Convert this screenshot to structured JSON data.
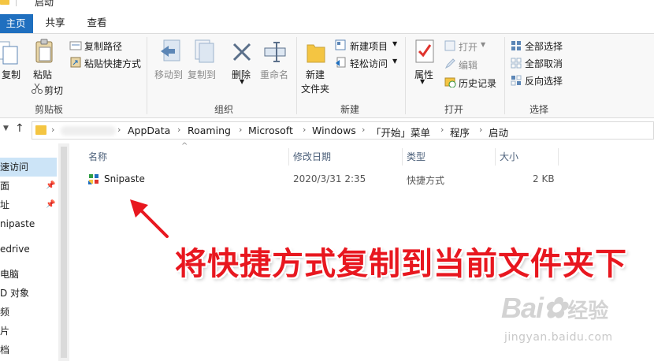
{
  "window": {
    "title": "启动"
  },
  "ribbon_tabs": [
    "主页",
    "共享",
    "查看"
  ],
  "ribbon": {
    "clipboard": {
      "copy": "复制",
      "paste": "粘贴",
      "copy_path": "复制路径",
      "paste_shortcut": "粘贴快捷方式",
      "cut": "剪切",
      "label": "剪贴板"
    },
    "organize": {
      "move_to": "移动到",
      "copy_to": "复制到",
      "delete": "删除",
      "rename": "重命名",
      "label": "组织"
    },
    "new": {
      "new_folder_line1": "新建",
      "new_folder_line2": "文件夹",
      "new_item": "新建项目",
      "easy_access": "轻松访问",
      "label": "新建"
    },
    "open": {
      "properties": "属性",
      "open": "打开",
      "edit": "编辑",
      "history": "历史记录",
      "label": "打开"
    },
    "select": {
      "select_all": "全部选择",
      "select_none": "全部取消",
      "invert": "反向选择",
      "label": "选择"
    }
  },
  "address_bar": {
    "crumbs": [
      "AppData",
      "Roaming",
      "Microsoft",
      "Windows",
      "「开始」菜单",
      "程序",
      "启动"
    ]
  },
  "nav_pane": {
    "items": [
      "速访问",
      "面",
      "址",
      "nipaste",
      "edrive",
      "电脑",
      "D 对象",
      "频",
      "片",
      "档"
    ]
  },
  "columns": {
    "name": "名称",
    "modified": "修改日期",
    "type": "类型",
    "size": "大小"
  },
  "files": [
    {
      "name": "Snipaste",
      "modified": "2020/3/31 2:35",
      "type": "快捷方式",
      "size": "2 KB"
    }
  ],
  "annotation": "将快捷方式复制到当前文件夹下",
  "watermark": {
    "logo": "Bai",
    "logo_cn": "经验",
    "url": "jingyan.baidu.com"
  },
  "colors": {
    "accent": "#1f6fbf",
    "annotation": "#e8171f",
    "folder": "#f4c542"
  }
}
